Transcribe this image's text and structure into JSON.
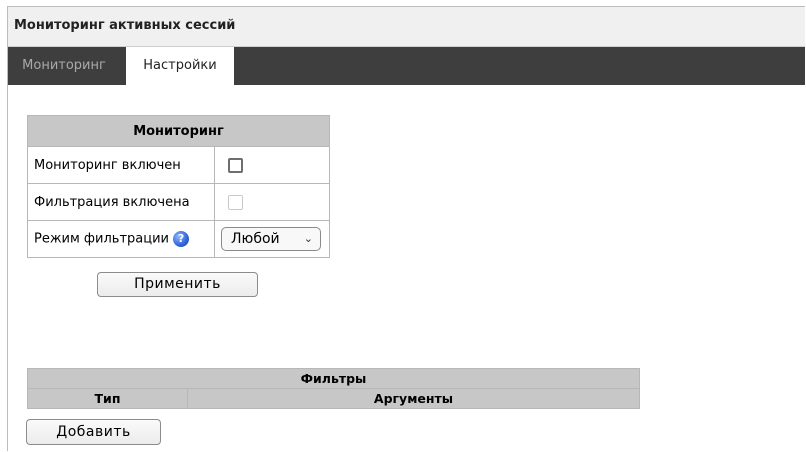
{
  "window": {
    "title": "Мониторинг активных сессий"
  },
  "tabs": [
    {
      "label": "Мониторинг",
      "active": false
    },
    {
      "label": "Настройки",
      "active": true
    }
  ],
  "monitoring": {
    "header": "Мониторинг",
    "rows": [
      {
        "label": "Мониторинг включен",
        "control": "checkbox",
        "checked": false,
        "disabled": false
      },
      {
        "label": "Фильтрация включена",
        "control": "checkbox",
        "checked": false,
        "disabled": true
      },
      {
        "label": "Режим фильтрации",
        "control": "select",
        "value": "Любой",
        "help_icon": "help-icon"
      }
    ],
    "apply_label": "Применить"
  },
  "filters": {
    "header": "Фильтры",
    "columns": [
      "Тип",
      "Аргументы"
    ],
    "rows": [],
    "add_label": "Добавить"
  },
  "colors": {
    "tab_bar_bg": "#3e3e3e",
    "table_header_bg": "#c7c7c7",
    "title_bar_bg": "#f0f0f0"
  }
}
